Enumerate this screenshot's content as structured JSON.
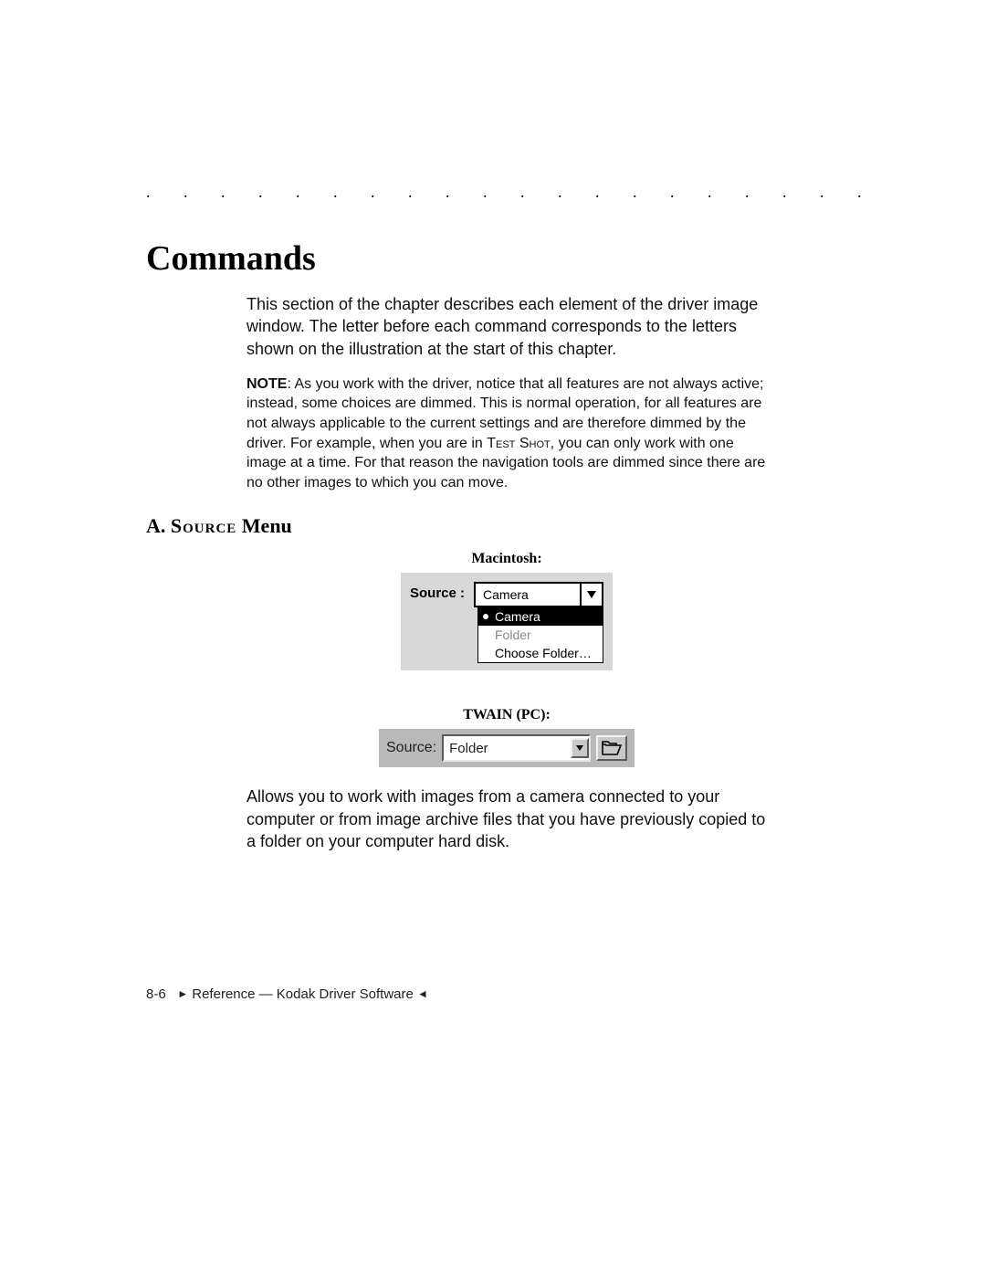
{
  "dotted_rule": ". . . . . . . . . . . . . . . . . . . . . . . . . . . . . .",
  "title": "Commands",
  "intro": "This section of the chapter describes each element of the driver image window. The letter before each command corresponds to the letters shown on the illustration at the start of this chapter.",
  "note_label": "NOTE",
  "note_text_before": ": As you work with the driver, notice that all features are not always active; instead, some choices are dimmed. This is normal operation, for all features are not always applicable to the current settings and are therefore dimmed by the driver. For example, when you are in ",
  "note_smallcaps": "Test Shot",
  "note_text_after": ", you can only work with one image at a time. For that reason the navigation tools are dimmed since there are no other images to which you can move.",
  "subsection_prefix": "A. ",
  "subsection_caps": "Source",
  "subsection_suffix": " Menu",
  "mac": {
    "caption": "Macintosh:",
    "label": "Source :",
    "selected": "Camera",
    "menu": {
      "item_selected": "Camera",
      "item_dimmed": "Folder",
      "item_choose": "Choose Folder…"
    }
  },
  "pc": {
    "caption": "TWAIN (PC):",
    "label": "Source:",
    "value": "Folder"
  },
  "desc": "Allows you to work with images from a camera connected to your computer or from image archive files that you have previously copied to a folder on your computer hard disk.",
  "footer": {
    "page": "8-6",
    "tri_right": "►",
    "middle": " Reference — Kodak Driver Software ",
    "tri_left": "◄"
  }
}
